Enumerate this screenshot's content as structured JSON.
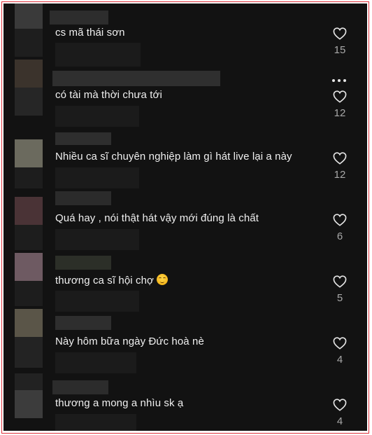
{
  "comments": [
    {
      "text": "cs mã thái sơn",
      "likes": "15",
      "avatar_color": "#3a3a3a"
    },
    {
      "text": "có tài mà thời chưa tới",
      "likes": "12",
      "avatar_color": "#3b332c"
    },
    {
      "text": "Nhiều ca sĩ chuyên nghiệp làm gì hát live lại a này",
      "likes": "12",
      "avatar_color": "#6b6a5e"
    },
    {
      "text": "Quá hay , nói thật hát vậy mới đúng là chất",
      "likes": "6",
      "avatar_color": "#4a3336"
    },
    {
      "text": "thương ca sĩ hội chợ",
      "likes": "5",
      "avatar_color": "#6e5a62",
      "emoji": "smiling-face-with-hearts"
    },
    {
      "text": "Này hôm bữa ngày Đức hoà nè",
      "likes": "4",
      "avatar_color": "#5a5548"
    },
    {
      "text": "thương a mong a nhìu sk ạ",
      "likes": "4",
      "avatar_color": "#3c3c3c"
    }
  ],
  "colors": {
    "background": "#121212",
    "text": "#f0f0f0",
    "muted": "#a8a8a8",
    "frame_border": "#e0313a"
  },
  "icons": {
    "like": "heart-outline-icon",
    "more": "more-horizontal-icon"
  }
}
